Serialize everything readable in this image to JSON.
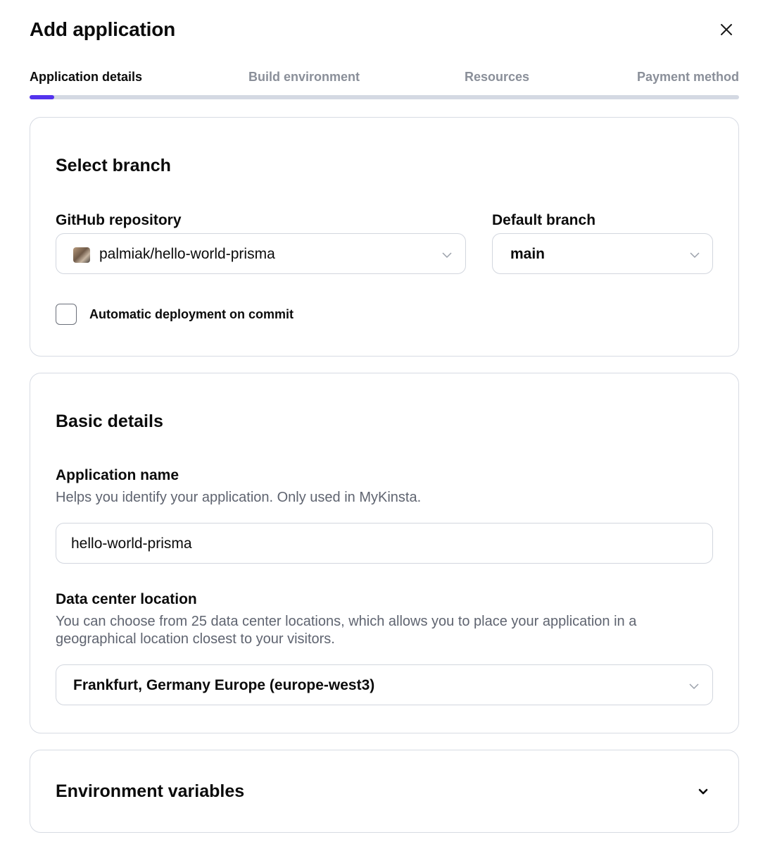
{
  "header": {
    "title": "Add application"
  },
  "stepper": {
    "steps": [
      {
        "label": "Application details"
      },
      {
        "label": "Build environment"
      },
      {
        "label": "Resources"
      },
      {
        "label": "Payment method"
      }
    ],
    "active_index": 0,
    "progress_fraction": 0.035,
    "accent_color": "#5333ed"
  },
  "select_branch": {
    "title": "Select branch",
    "repository": {
      "label": "GitHub repository",
      "value": "palmiak/hello-world-prisma"
    },
    "branch": {
      "label": "Default branch",
      "value": "main"
    },
    "auto_deploy": {
      "label": "Automatic deployment on commit",
      "checked": false
    }
  },
  "basic_details": {
    "title": "Basic details",
    "app_name": {
      "label": "Application name",
      "help": "Helps you identify your application. Only used in MyKinsta.",
      "value": "hello-world-prisma"
    },
    "location": {
      "label": "Data center location",
      "help": "You can choose from 25 data center locations, which allows you to place your application in a geographical location closest to your visitors.",
      "value": "Frankfurt, Germany Europe (europe-west3)"
    }
  },
  "env_vars": {
    "title": "Environment variables"
  },
  "icons": {
    "close": "close-icon",
    "chevron": "chevron-down-icon",
    "avatar": "repo-owner-avatar"
  }
}
